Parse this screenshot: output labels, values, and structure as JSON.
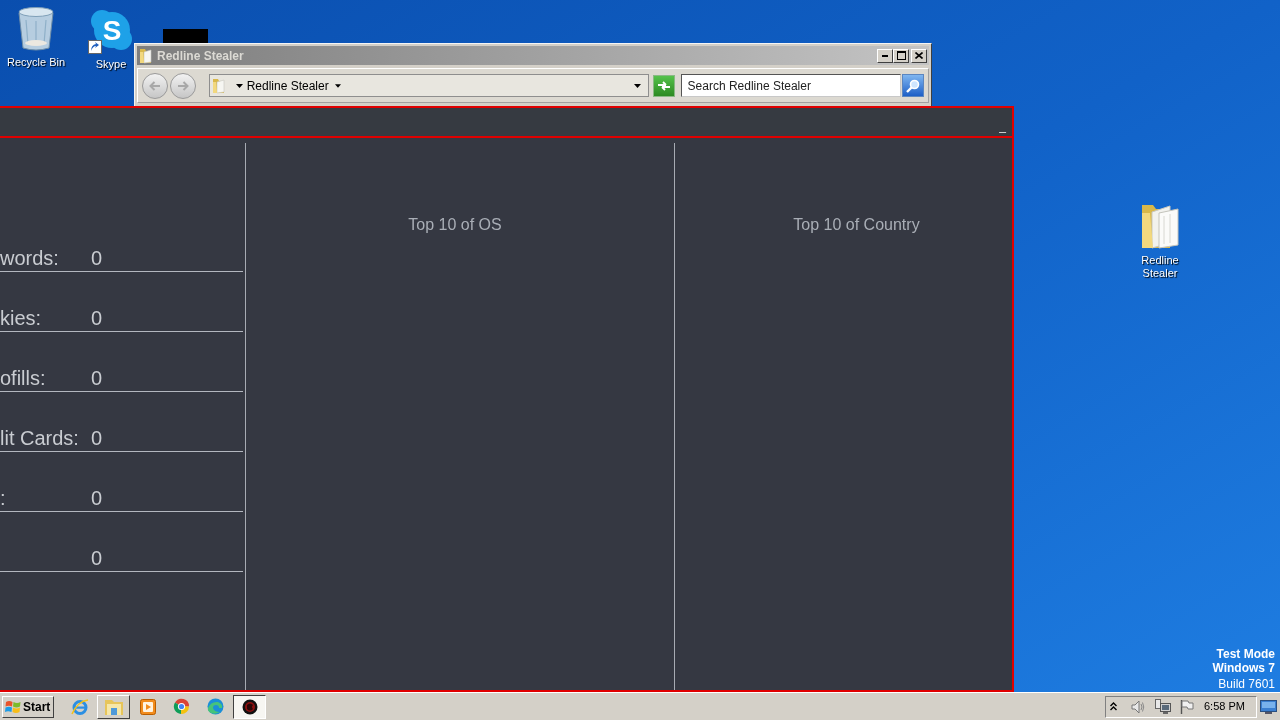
{
  "desktop": {
    "icons": [
      {
        "kind": "recycle_bin",
        "label": "Recycle Bin"
      },
      {
        "kind": "shortcut",
        "label": "Skype",
        "logo_letter": "S"
      },
      {
        "kind": "folder",
        "label": "Redline Stealer"
      }
    ],
    "system_notice": [
      "Test Mode",
      "Windows 7",
      "Build 7601"
    ]
  },
  "explorer_window": {
    "title": "Redline Stealer",
    "address": "Redline Stealer",
    "search": {
      "placeholder": "Search Redline Stealer"
    }
  },
  "app_window": {
    "minimize": "_",
    "stats": [
      {
        "label": "words:",
        "value": "0"
      },
      {
        "label": "kies:",
        "value": "0"
      },
      {
        "label": "ofills:",
        "value": "0"
      },
      {
        "label": "lit Cards:",
        "value": "0"
      },
      {
        "label": ":",
        "value": "0"
      },
      {
        "value": "0"
      }
    ],
    "panels": [
      {
        "title": "Top 10 of OS"
      },
      {
        "title": "Top 10 of Country"
      }
    ]
  },
  "taskbar": {
    "start": "Start",
    "buttons": [
      {
        "kind": "ie",
        "open": false,
        "selected": false
      },
      {
        "kind": "folder",
        "open": true,
        "selected": false
      },
      {
        "kind": "media",
        "open": false,
        "selected": false
      },
      {
        "kind": "chrome",
        "open": false,
        "selected": false
      },
      {
        "kind": "edge",
        "open": false,
        "selected": false
      },
      {
        "kind": "app",
        "open": true,
        "selected": true
      }
    ],
    "clock": "6:58 PM"
  }
}
